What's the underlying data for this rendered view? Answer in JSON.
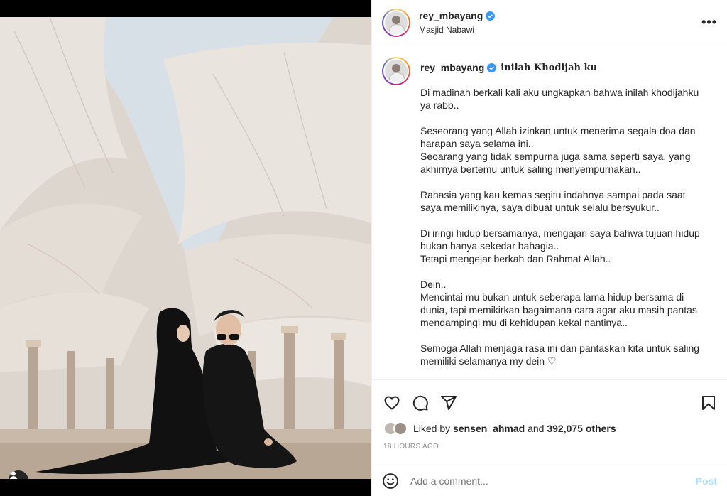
{
  "post": {
    "username": "rey_mbayang",
    "location": "Masjid Nabawi",
    "more_label": "•••"
  },
  "caption": {
    "username": "rey_mbayang",
    "title": "inilah Khodijah ku",
    "text": "Di madinah berkali kali aku ungkapkan bahwa inilah khodijahku ya rabb..\n\nSeseorang yang Allah izinkan untuk menerima segala doa dan harapan saya selama ini..\nSeoarang yang tidak sempurna juga sama seperti saya, yang akhirnya bertemu untuk saling menyempurnakan..\n\nRahasia yang kau kemas segitu indahnya sampai pada saat saya memilikinya, saya dibuat untuk selalu bersyukur..\n\nDi iringi hidup bersamanya, mengajari saya bahwa tujuan hidup bukan hanya sekedar bahagia..\nTetapi mengejar berkah dan Rahmat Allah..\n\nDein..\nMencintai mu bukan untuk seberapa lama hidup bersama di dunia, tapi memikirkan bagaimana cara agar aku masih pantas mendampingi mu di kehidupan kekal nantinya..\n\nSemoga Allah menjaga rasa ini dan pantaskan kita untuk saling memiliki selamanya my dein ♡"
  },
  "likes": {
    "prefix": "Liked by",
    "user": "sensen_ahmad",
    "middle": "and",
    "count": "392,075 others"
  },
  "timestamp": "18 HOURS AGO",
  "comment_box": {
    "placeholder": "Add a comment...",
    "post_label": "Post"
  },
  "icons": {
    "like": "heart-icon",
    "comment": "comment-icon",
    "share": "send-icon",
    "save": "bookmark-icon",
    "emoji": "smile-icon",
    "tag": "user-tag-icon"
  },
  "colors": {
    "verified": "#3897f0",
    "post_disabled": "#b2dffc",
    "muted": "#8e8e8e"
  }
}
